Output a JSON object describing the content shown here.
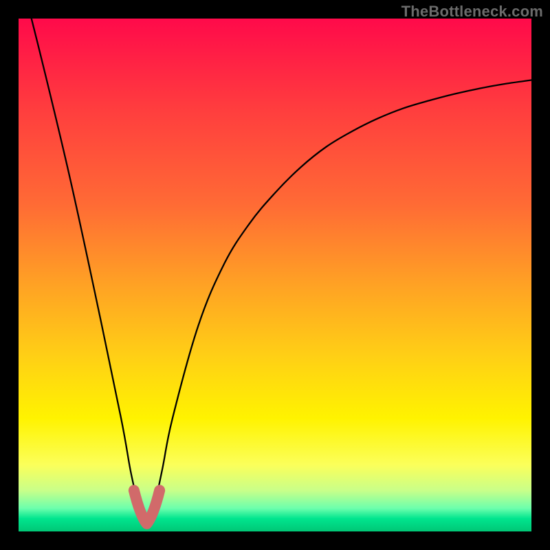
{
  "attribution": "TheBottleneck.com",
  "chart_data": {
    "type": "line",
    "title": "",
    "xlabel": "",
    "ylabel": "",
    "xlim": [
      0,
      100
    ],
    "ylim": [
      0,
      100
    ],
    "x": [
      0,
      5,
      10,
      15,
      20,
      22,
      24,
      25,
      26,
      28,
      30,
      35,
      40,
      45,
      50,
      55,
      60,
      65,
      70,
      75,
      80,
      85,
      90,
      95,
      100
    ],
    "y": [
      110,
      90,
      69,
      46,
      22,
      11,
      3,
      2,
      3,
      12,
      22,
      40,
      52,
      60,
      66,
      71,
      75,
      78,
      80.5,
      82.5,
      84,
      85.3,
      86.4,
      87.3,
      88
    ],
    "minimum_marker": {
      "x_range": [
        22.5,
        27.5
      ],
      "y_range": [
        1.5,
        8
      ],
      "color": "#d16a6a"
    },
    "gradient_stops": [
      {
        "pos": 0.0,
        "color": "#ff0a4a"
      },
      {
        "pos": 0.18,
        "color": "#ff3e3e"
      },
      {
        "pos": 0.36,
        "color": "#ff6a35"
      },
      {
        "pos": 0.52,
        "color": "#ffa224"
      },
      {
        "pos": 0.66,
        "color": "#ffd015"
      },
      {
        "pos": 0.78,
        "color": "#fff300"
      },
      {
        "pos": 0.87,
        "color": "#fbff5a"
      },
      {
        "pos": 0.92,
        "color": "#c9ff89"
      },
      {
        "pos": 0.955,
        "color": "#6cffad"
      },
      {
        "pos": 0.975,
        "color": "#00e58e"
      },
      {
        "pos": 1.0,
        "color": "#00c776"
      }
    ]
  }
}
